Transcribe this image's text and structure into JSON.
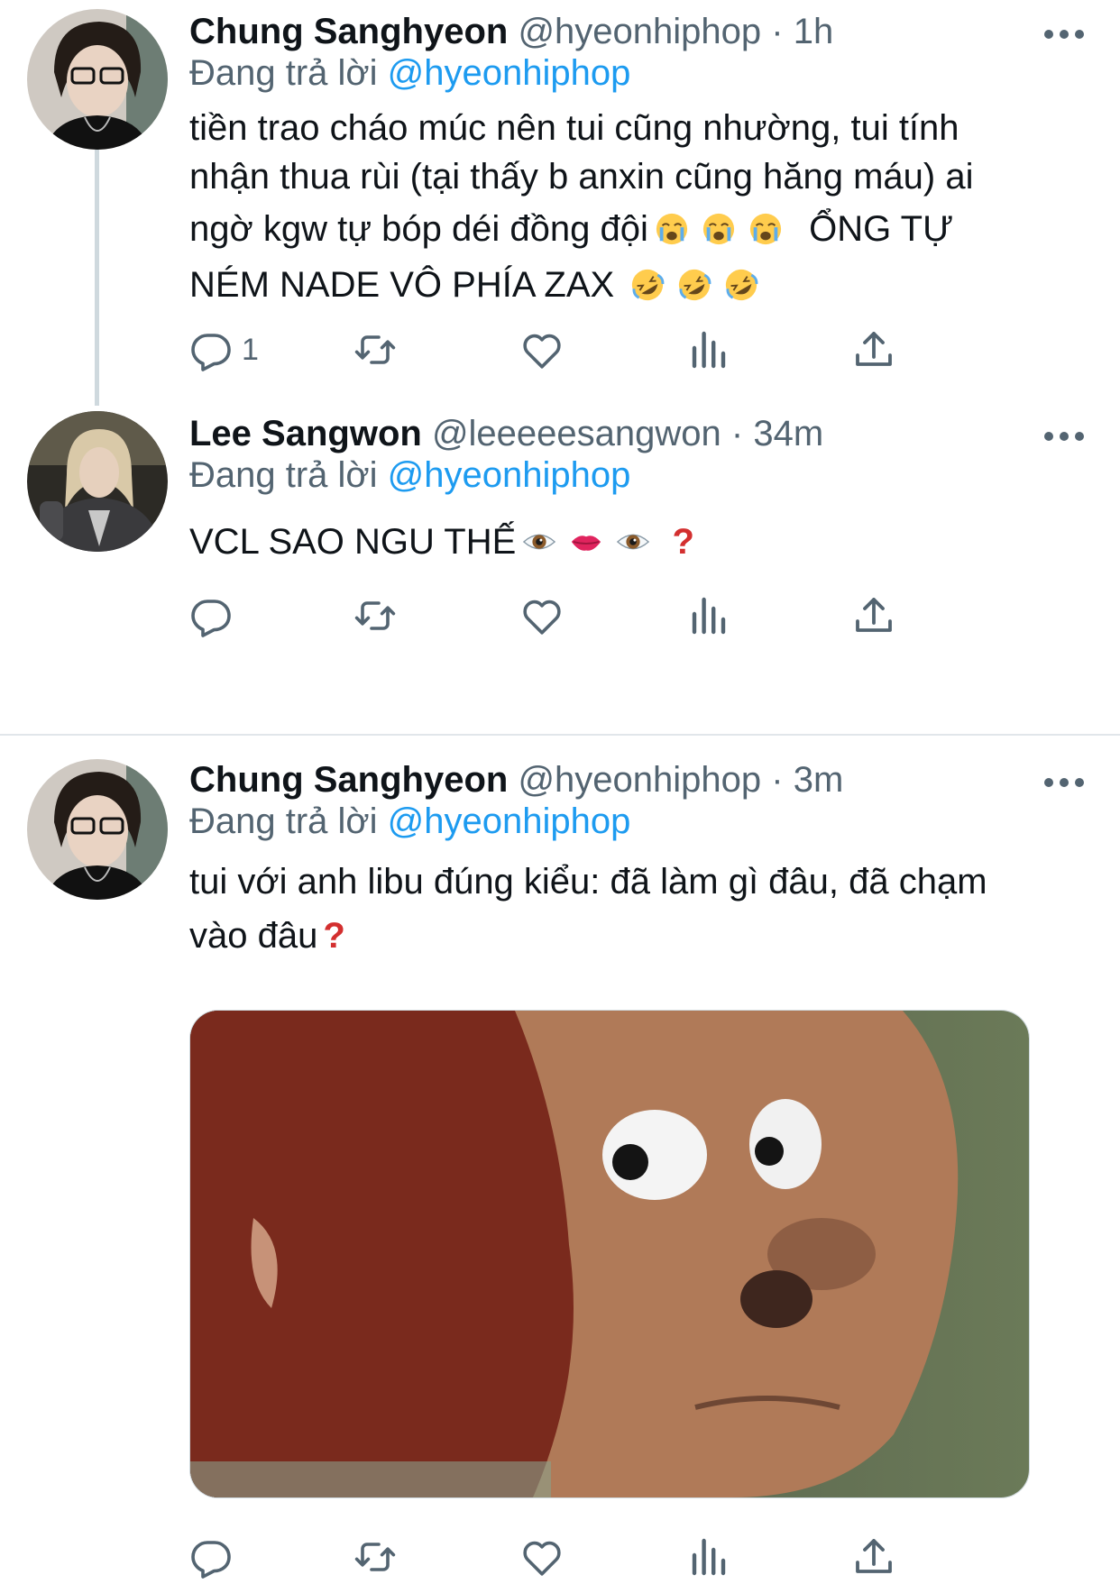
{
  "tweets": [
    {
      "name": "Chung Sanghyeon",
      "handle": "@hyeonhiphop",
      "dot": "·",
      "time": "1h",
      "replying_prefix": "Đang trả lời",
      "replying_to": "@hyeonhiphop",
      "text_lines": [
        "tiền trao cháo múc nên tui cũng nhường, tui tính",
        "nhận thua rùi (tại thấy b anxin cũng hăng máu) ai",
        "ngờ kgw tự bóp déi đồng đội",
        "ỔNG TỰ",
        "NÉM NADE VÔ PHÍA ZAX"
      ],
      "emoji": [
        "loudly-crying-face",
        "rolling-on-floor-laughing"
      ],
      "reply_count": "1"
    },
    {
      "name": "Lee Sangwon",
      "handle": "@leeeeesangwon",
      "dot": "·",
      "time": "34m",
      "replying_prefix": "Đang trả lời",
      "replying_to": "@hyeonhiphop",
      "text_lines": [
        "VCL SAO NGU THẾ"
      ],
      "emoji": [
        "eye",
        "lips",
        "eye",
        "red-question-mark"
      ],
      "reply_count": ""
    },
    {
      "name": "Chung Sanghyeon",
      "handle": "@hyeonhiphop",
      "dot": "·",
      "time": "3m",
      "replying_prefix": "Đang trả lời",
      "replying_to": "@hyeonhiphop",
      "text_lines": [
        "tui với anh libu đúng kiểu: đã làm gì đâu, đã chạm",
        "vào đâu"
      ],
      "emoji": [
        "red-question-mark"
      ],
      "media": "monkey-puppet-side-eye-meme",
      "reply_count": ""
    }
  ],
  "question_mark": "?",
  "colors": {
    "text": "#0f1419",
    "secondary": "#536471",
    "link": "#1d9bf0",
    "divider": "#e1e6ea",
    "thread_line": "#cfd9de"
  },
  "icons": [
    "reply-icon",
    "retweet-icon",
    "like-icon",
    "analytics-icon",
    "share-icon",
    "more-icon"
  ]
}
